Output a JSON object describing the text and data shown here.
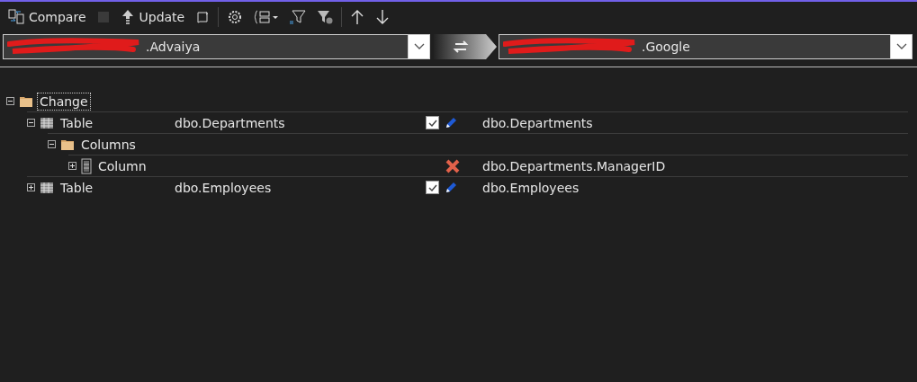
{
  "toolbar": {
    "compare_label": "Compare",
    "update_label": "Update",
    "stop_disabled": true
  },
  "source": {
    "value": ".Advaiya"
  },
  "target": {
    "value": ".Google"
  },
  "tree": [
    {
      "kind": "folder",
      "name": "Change",
      "expanded": true,
      "focused": true,
      "children": [
        {
          "kind": "table",
          "name": "Table",
          "source": "dbo.Departments",
          "checked": true,
          "deleted": false,
          "target": "dbo.Departments",
          "expanded": true,
          "children": [
            {
              "kind": "folder",
              "name": "Columns",
              "expanded": true,
              "children": [
                {
                  "kind": "column",
                  "name": "Column",
                  "deleted": true,
                  "target": "dbo.Departments.ManagerID",
                  "expanded": false
                }
              ]
            }
          ]
        },
        {
          "kind": "table",
          "name": "Table",
          "source": "dbo.Employees",
          "checked": true,
          "deleted": false,
          "target": "dbo.Employees",
          "expanded": false
        }
      ]
    }
  ]
}
